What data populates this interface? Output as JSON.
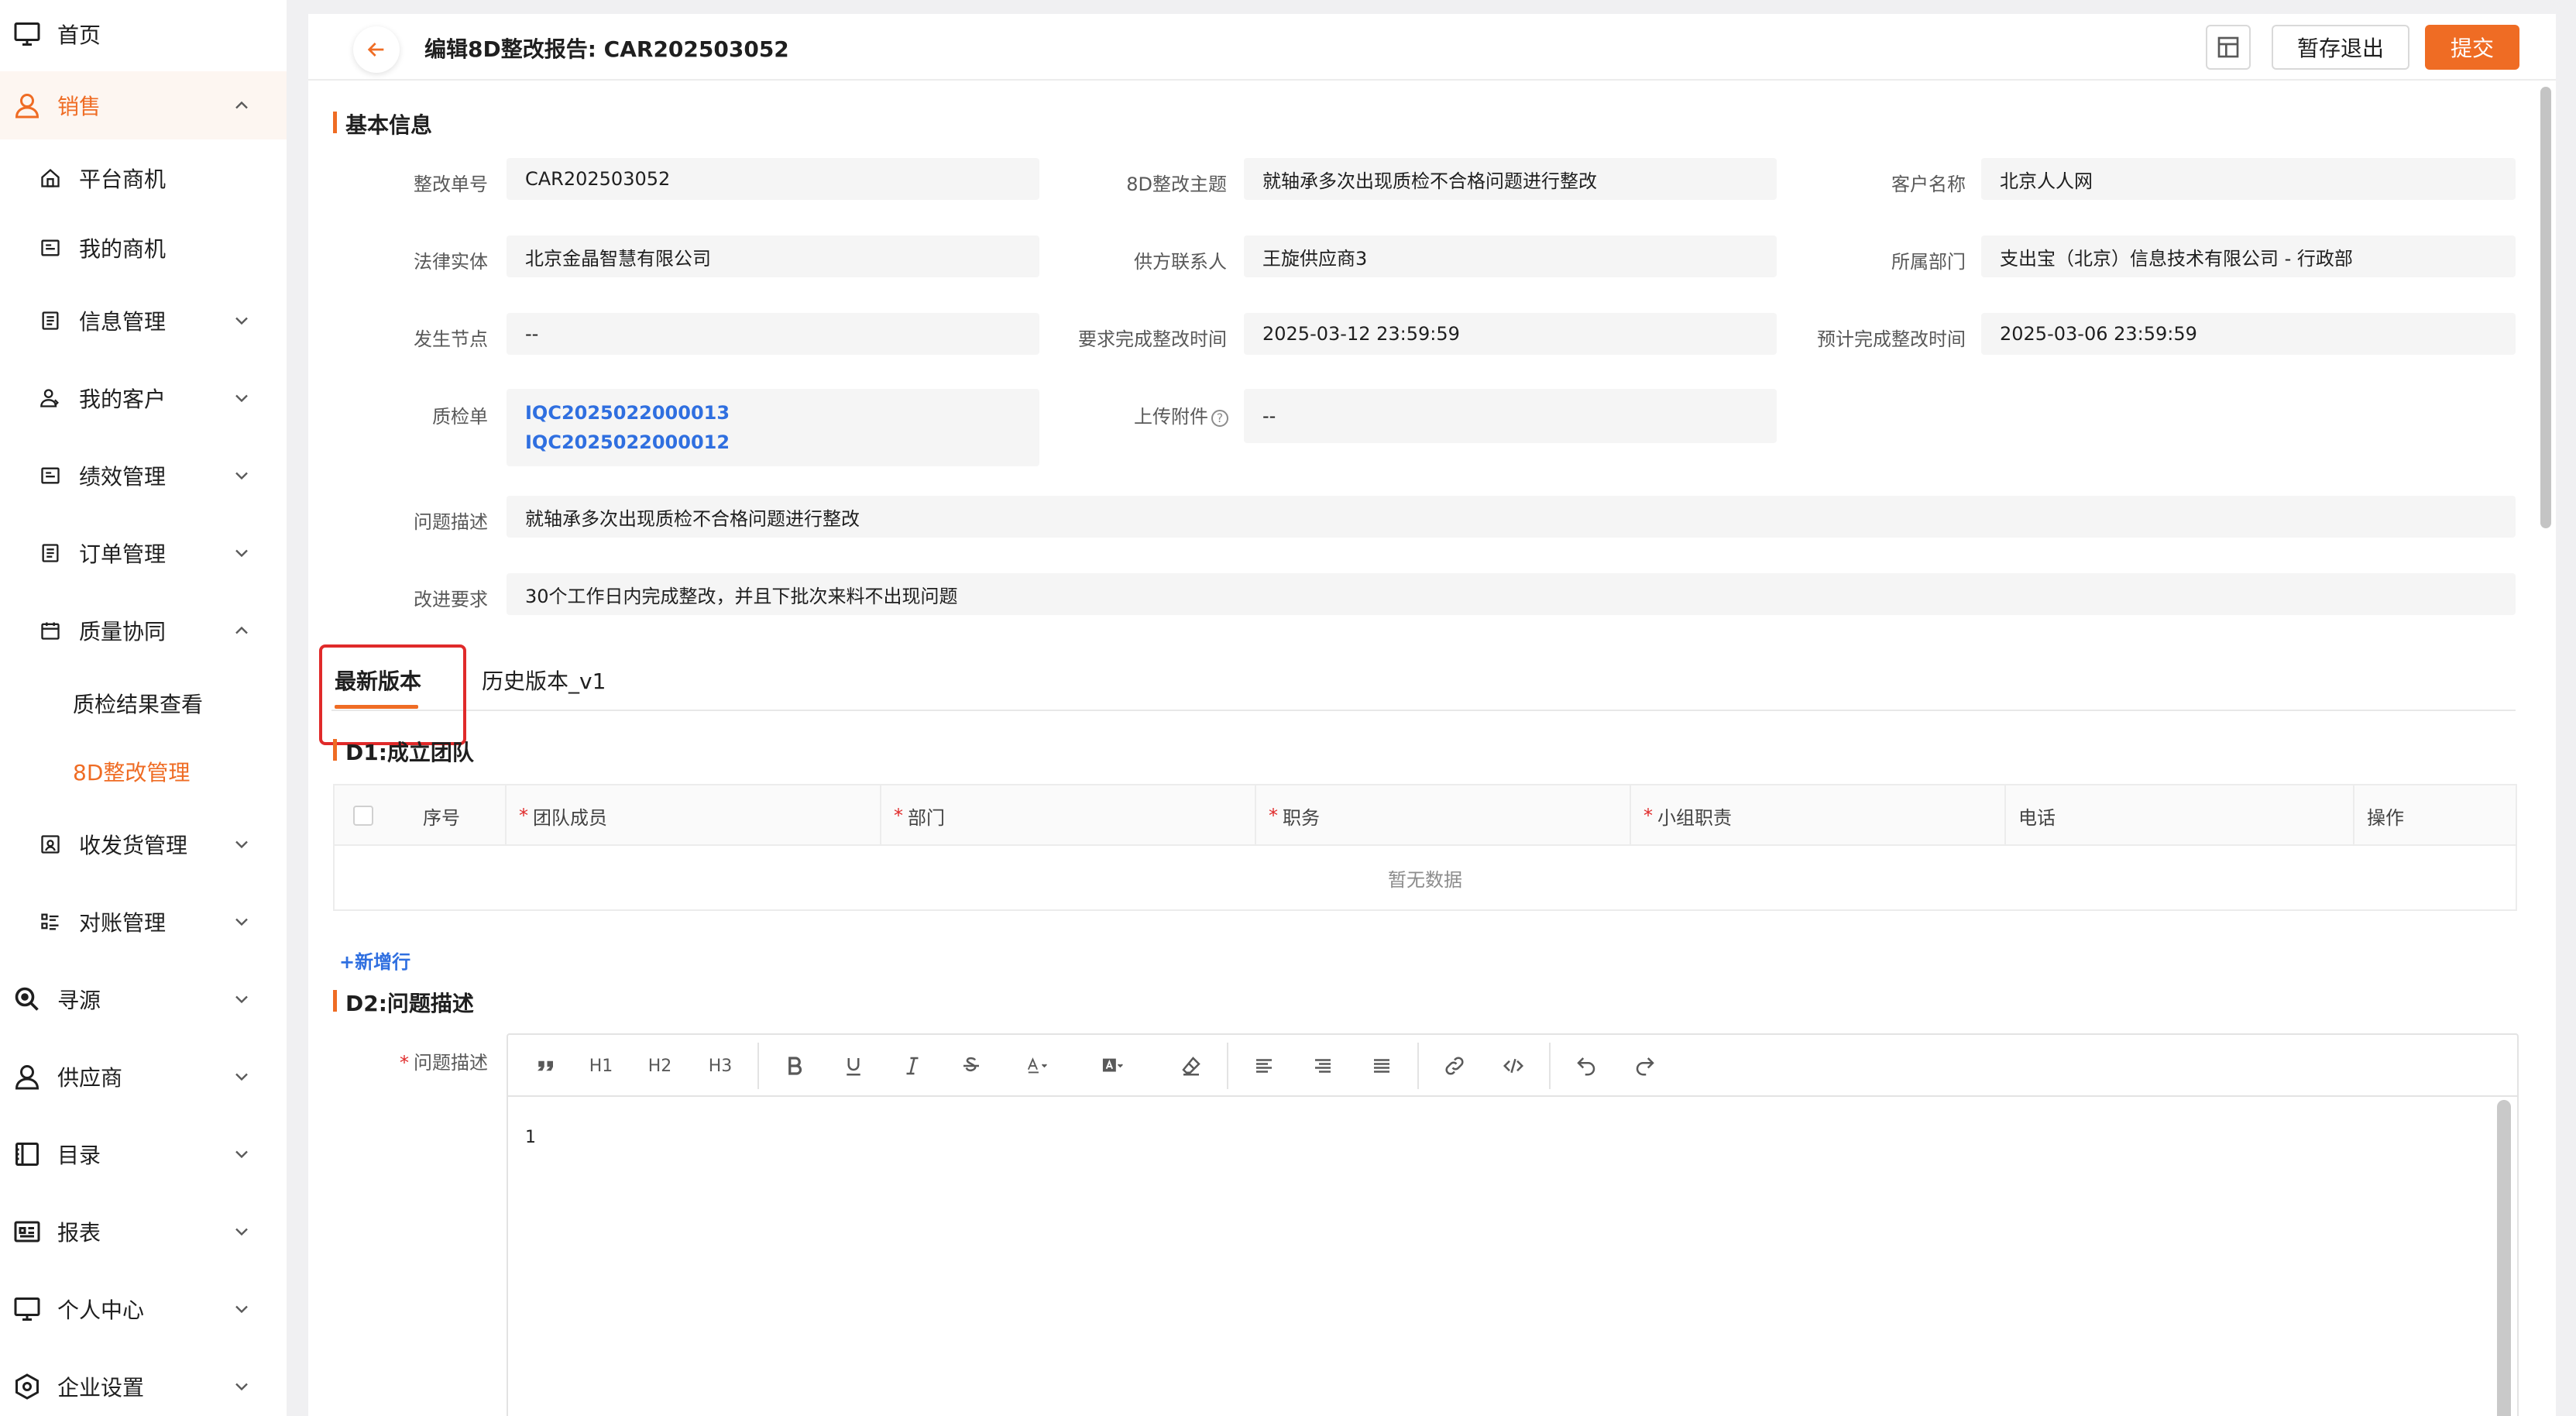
{
  "sidebar": {
    "items": [
      {
        "label": "首页",
        "icon": "monitor-icon"
      },
      {
        "label": "销售",
        "icon": "user-icon"
      },
      {
        "label": "平台商机",
        "icon": "home-icon"
      },
      {
        "label": "我的商机",
        "icon": "card-icon"
      },
      {
        "label": "信息管理",
        "icon": "list-icon"
      },
      {
        "label": "我的客户",
        "icon": "customer-icon"
      },
      {
        "label": "绩效管理",
        "icon": "card-icon"
      },
      {
        "label": "订单管理",
        "icon": "list-icon"
      },
      {
        "label": "质量协同",
        "icon": "calendar-icon"
      },
      {
        "label": "质检结果查看"
      },
      {
        "label": "8D整改管理"
      },
      {
        "label": "收发货管理",
        "icon": "package-icon"
      },
      {
        "label": "对账管理",
        "icon": "checklist-icon"
      },
      {
        "label": "寻源",
        "icon": "search-icon"
      },
      {
        "label": "供应商",
        "icon": "user-icon"
      },
      {
        "label": "目录",
        "icon": "book-icon"
      },
      {
        "label": "报表",
        "icon": "report-icon"
      },
      {
        "label": "个人中心",
        "icon": "monitor-icon"
      },
      {
        "label": "企业设置",
        "icon": "hexagon-icon"
      }
    ]
  },
  "header": {
    "title": "编辑8D整改报告: CAR202503052",
    "save_label": "暂存退出",
    "submit_label": "提交"
  },
  "basic": {
    "title": "基本信息",
    "fields": [
      {
        "label": "整改单号",
        "value": "CAR202503052"
      },
      {
        "label": "8D整改主题",
        "value": "就轴承多次出现质检不合格问题进行整改"
      },
      {
        "label": "客户名称",
        "value": "北京人人网"
      },
      {
        "label": "法律实体",
        "value": "北京金晶智慧有限公司"
      },
      {
        "label": "供方联系人",
        "value": "王旋供应商3"
      },
      {
        "label": "所属部门",
        "value": "支出宝（北京）信息技术有限公司 - 行政部"
      },
      {
        "label": "发生节点",
        "value": "--"
      },
      {
        "label": "要求完成整改时间",
        "value": "2025-03-12 23:59:59"
      },
      {
        "label": "预计完成整改时间",
        "value": "2025-03-06 23:59:59"
      },
      {
        "label": "质检单",
        "links": [
          "IQC2025022000013",
          "IQC2025022000012"
        ]
      },
      {
        "label": "上传附件",
        "value": "--"
      },
      {
        "label": "问题描述",
        "value": "就轴承多次出现质检不合格问题进行整改"
      },
      {
        "label": "改进要求",
        "value": "30个工作日内完成整改，并且下批次来料不出现问题"
      }
    ]
  },
  "tabs": [
    {
      "label": "最新版本",
      "active": true
    },
    {
      "label": "历史版本_v1",
      "active": false
    }
  ],
  "d1": {
    "title": "D1:成立团队",
    "columns": [
      {
        "label": "序号",
        "required": false
      },
      {
        "label": "团队成员",
        "required": true
      },
      {
        "label": "部门",
        "required": true
      },
      {
        "label": "职务",
        "required": true
      },
      {
        "label": "小组职责",
        "required": true
      },
      {
        "label": "电话",
        "required": false
      },
      {
        "label": "操作",
        "required": false
      }
    ],
    "required_mark": "*",
    "empty_text": "暂无数据",
    "add_row": "+新增行"
  },
  "d2": {
    "title": "D2:问题描述",
    "field_label": "问题描述",
    "toolbar": {
      "h1": "H1",
      "h2": "H2",
      "h3": "H3"
    },
    "content": "1"
  },
  "colors": {
    "accent": "#ef6c24",
    "link": "#2f6fe0",
    "highlight": "#e02a2a"
  }
}
